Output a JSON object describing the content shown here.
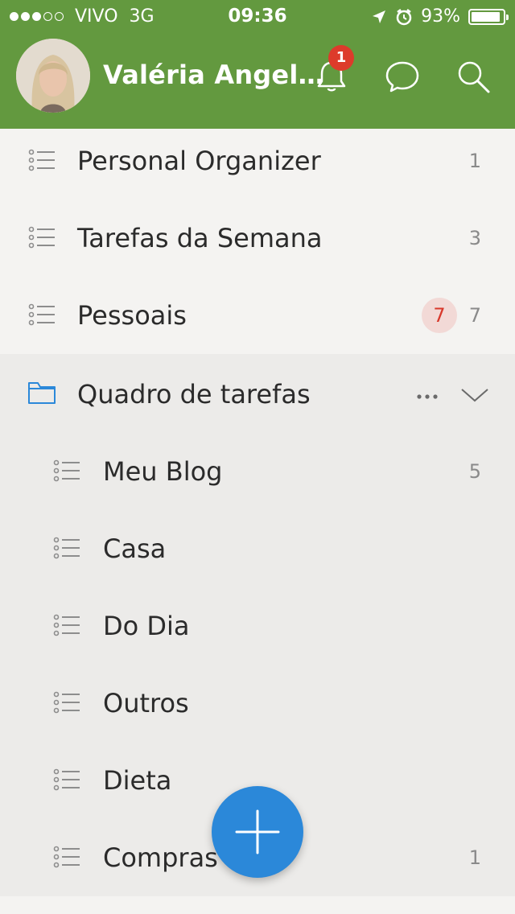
{
  "status_bar": {
    "carrier": "VIVO",
    "network": "3G",
    "time": "09:36",
    "battery": "93%",
    "battery_level": 0.93,
    "signal_bars_filled": 3,
    "signal_bars_total": 5
  },
  "header": {
    "user_name": "Valéria Angel…",
    "notification_count": "1",
    "background_color": "#63993f"
  },
  "lists": [
    {
      "label": "Personal Organizer",
      "count": "1",
      "icon": "list-icon"
    },
    {
      "label": "Tarefas da Semana",
      "count": "3",
      "icon": "list-icon"
    },
    {
      "label": "Pessoais",
      "count": "7",
      "overdue": "7",
      "icon": "list-icon"
    }
  ],
  "folder": {
    "label": "Quadro de tarefas",
    "icon": "folder-icon",
    "items": [
      {
        "label": "Meu Blog",
        "count": "5"
      },
      {
        "label": "Casa",
        "count": ""
      },
      {
        "label": "Do Dia",
        "count": ""
      },
      {
        "label": "Outros",
        "count": ""
      },
      {
        "label": "Dieta",
        "count": ""
      },
      {
        "label": "Compras",
        "count": "1"
      }
    ]
  },
  "colors": {
    "accent": "#2b88d9",
    "overdue": "#d8382b",
    "header": "#63993f"
  }
}
